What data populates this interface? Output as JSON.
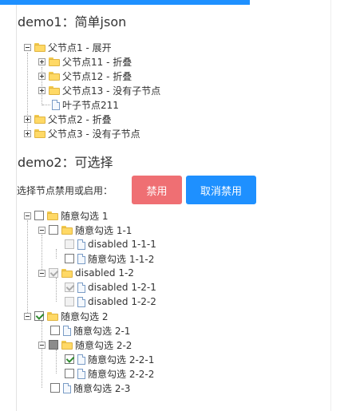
{
  "demo1": {
    "title": "demo1：简单json",
    "nodes": [
      {
        "label": "父节点1 - 展开"
      },
      {
        "label": "父节点11 - 折叠"
      },
      {
        "label": "父节点12 - 折叠"
      },
      {
        "label": "父节点13 - 没有子节点"
      },
      {
        "label": "叶子节点211"
      },
      {
        "label": "父节点2 - 折叠"
      },
      {
        "label": "父节点3 - 没有子节点"
      }
    ]
  },
  "demo2": {
    "title": "demo2：可选择",
    "prompt": "选择节点禁用或启用：",
    "disable_button": "禁用",
    "enable_button": "取消禁用",
    "nodes": [
      {
        "label": "随意勾选 1"
      },
      {
        "label": "随意勾选 1-1"
      },
      {
        "label": "disabled 1-1-1"
      },
      {
        "label": "随意勾选 1-1-2"
      },
      {
        "label": "disabled 1-2"
      },
      {
        "label": "disabled 1-2-1"
      },
      {
        "label": "disabled 1-2-2"
      },
      {
        "label": "随意勾选 2"
      },
      {
        "label": "随意勾选 2-1"
      },
      {
        "label": "随意勾选 2-2"
      },
      {
        "label": "随意勾选 2-2-1"
      },
      {
        "label": "随意勾选 2-2-2"
      },
      {
        "label": "随意勾选 2-3"
      }
    ]
  },
  "colors": {
    "accent_blue": "#1e90ff",
    "disable_red": "#ef6f73",
    "check_green": "#2e8b2e",
    "folder_yellow": "#ffd966"
  }
}
